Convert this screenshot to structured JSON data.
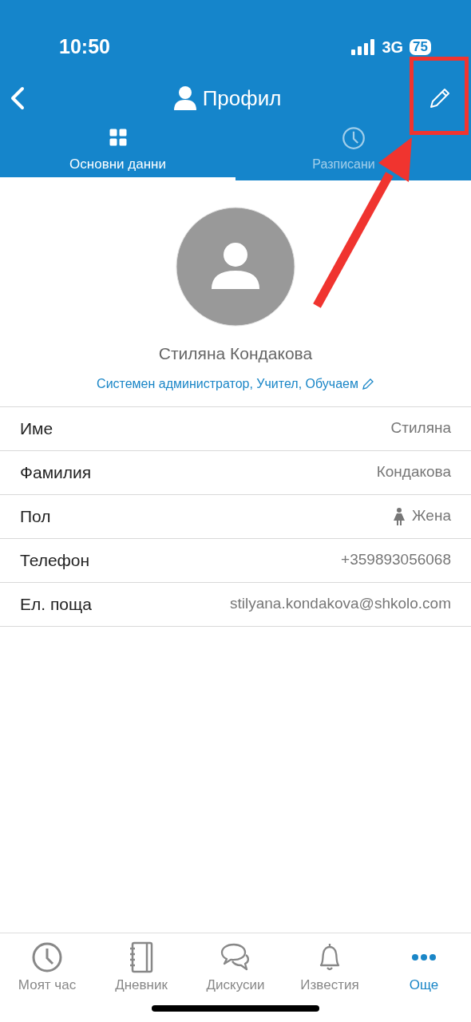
{
  "status_bar": {
    "time": "10:50",
    "network": "3G",
    "battery": "75"
  },
  "header": {
    "title": "Профил"
  },
  "tabs": [
    {
      "label": "Основни данни",
      "selected": true
    },
    {
      "label": "Разписани",
      "selected": false
    }
  ],
  "profile": {
    "name": "Стиляна Кондакова",
    "roles": "Системен администратор, Учител, Обучаем"
  },
  "fields": [
    {
      "label": "Име",
      "value": "Стиляна"
    },
    {
      "label": "Фамилия",
      "value": "Кондакова"
    },
    {
      "label": "Пол",
      "value": "Жена",
      "kind": "gender"
    },
    {
      "label": "Телефон",
      "value": "+359893056068"
    },
    {
      "label": "Ел. поща",
      "value": "stilyana.kondakova@shkolo.com"
    }
  ],
  "bottom_nav": [
    {
      "label": "Моят час",
      "selected": false
    },
    {
      "label": "Дневник",
      "selected": false
    },
    {
      "label": "Дискусии",
      "selected": false
    },
    {
      "label": "Известия",
      "selected": false
    },
    {
      "label": "Още",
      "selected": true
    }
  ],
  "annotation": {
    "kind": "box_with_arrow"
  }
}
